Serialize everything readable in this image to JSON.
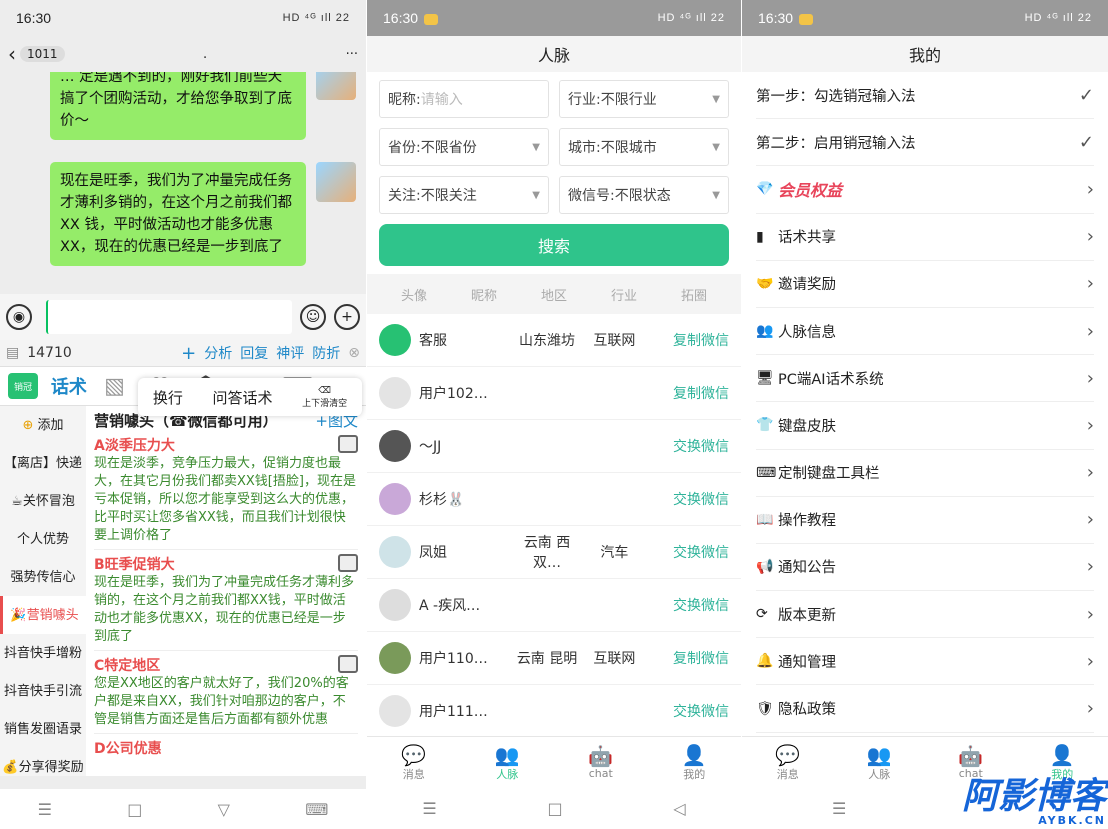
{
  "status": {
    "time": "16:30",
    "indicators": "HD ⁴ᴳ ıll 22"
  },
  "chat": {
    "back": "‹",
    "count": "1011",
    "title": ".",
    "more": "···",
    "msg1": "…  定是遇不到的，刚好我们前些天搞了个团购活动，才给您争取到了底价～",
    "msg2": "现在是旺季，我们为了冲量完成任务才薄利多销的，在这个月之前我们都 XX 钱，平时做活动也才能多优惠 XX，现在的优惠已经是一步到底了",
    "toolrow": {
      "num": "14710",
      "plus": "+",
      "items": [
        "分析",
        "回复",
        "神评",
        "防折"
      ],
      "close": "⊗"
    },
    "icons": {
      "logo": "销冠",
      "speech": "话术",
      "keyboard_ai": "AI"
    },
    "cats": [
      "添加",
      "【离店】快递",
      "☕关怀冒泡",
      "个人优势",
      "强势传信心",
      "🎉营销噱头",
      "抖音快手增粉",
      "抖音快手引流",
      "销售发圈语录",
      "💰分享得奖励"
    ],
    "active_cat": 5,
    "heading": "营销噱头（☎微信都可用）",
    "add": "+图文",
    "items": [
      {
        "t": "A淡季压力大",
        "b": "现在是淡季，竞争压力最大，促销力度也最大，在其它月份我们都卖XX钱[捂脸]，现在是亏本促销，所以您才能享受到这么大的优惠，比平时买让您多省XX钱，而且我们计划很快要上调价格了"
      },
      {
        "t": "B旺季促销大",
        "b": "现在是旺季，我们为了冲量完成任务才薄利多销的，在这个月之前我们都XX钱，平时做活动也才能多优惠XX，现在的优惠已经是一步到底了"
      },
      {
        "t": "C特定地区",
        "b": "您是XX地区的客户就太好了，我们20%的客户都是来自XX，我们针对咱那边的客户，不管是销售方面还是售后方面都有额外优惠"
      },
      {
        "t": "D公司优惠",
        "b": ""
      }
    ],
    "float": {
      "wrap": "换行",
      "qa": "问答话术",
      "del": "上下滑清空"
    }
  },
  "renmai": {
    "title": "人脉",
    "filters": [
      [
        "昵称:",
        "请输入"
      ],
      [
        "行业:不限行业"
      ],
      [
        "省份:不限省份"
      ],
      [
        "城市:不限城市"
      ],
      [
        "关注:不限关注"
      ],
      [
        "微信号:不限状态"
      ]
    ],
    "search": "搜索",
    "cols": [
      "头像",
      "昵称",
      "地区",
      "行业",
      "拓圈"
    ],
    "rows": [
      {
        "name": "客服",
        "region": "山东潍坊",
        "industry": "互联网",
        "act": "复制微信",
        "color": "#27c173"
      },
      {
        "name": "用户102…",
        "region": "",
        "industry": "",
        "act": "复制微信",
        "color": "#e4e4e4"
      },
      {
        "name": "～JJ",
        "region": "",
        "industry": "",
        "act": "交换微信",
        "color": "#555"
      },
      {
        "name": "杉杉🐰",
        "region": "",
        "industry": "",
        "act": "交换微信",
        "color": "#c9a8d8"
      },
      {
        "name": "凤姐",
        "region": "云南 西双…",
        "industry": "汽车",
        "act": "交换微信",
        "color": "#cfe3e8"
      },
      {
        "name": "A -疾风…",
        "region": "",
        "industry": "",
        "act": "交换微信",
        "color": "#ddd"
      },
      {
        "name": "用户110…",
        "region": "云南 昆明",
        "industry": "互联网",
        "act": "复制微信",
        "color": "#7a9a5a"
      },
      {
        "name": "用户111…",
        "region": "",
        "industry": "",
        "act": "交换微信",
        "color": "#e4e4e4"
      }
    ]
  },
  "mine": {
    "title": "我的",
    "items": [
      {
        "icon": "",
        "label": "第一步：勾选销冠输入法",
        "end": "✓"
      },
      {
        "icon": "",
        "label": "第二步：启用销冠输入法",
        "end": "✓"
      },
      {
        "icon": "💎",
        "label": "会员权益",
        "end": "›",
        "vip": true
      },
      {
        "icon": "▮",
        "label": "话术共享",
        "end": "›"
      },
      {
        "icon": "🤝",
        "label": "邀请奖励",
        "end": "›"
      },
      {
        "icon": "👥",
        "label": "人脉信息",
        "end": "›"
      },
      {
        "icon": "🖥",
        "label": "PC端AI话术系统",
        "end": "›"
      },
      {
        "icon": "👕",
        "label": "键盘皮肤",
        "end": "›"
      },
      {
        "icon": "⌨",
        "label": "定制键盘工具栏",
        "end": "›"
      },
      {
        "icon": "📖",
        "label": "操作教程",
        "end": "›"
      },
      {
        "icon": "📢",
        "label": "通知公告",
        "end": "›"
      },
      {
        "icon": "⟳",
        "label": "版本更新",
        "end": "›"
      },
      {
        "icon": "🔔",
        "label": "通知管理",
        "end": "›"
      },
      {
        "icon": "🛡",
        "label": "隐私政策",
        "end": "›"
      }
    ]
  },
  "tabs": [
    {
      "icon": "💬",
      "label": "消息"
    },
    {
      "icon": "👤",
      "label": "人脉"
    },
    {
      "icon": "🤖",
      "label": "chat"
    },
    {
      "icon": "👤",
      "label": "我的"
    }
  ],
  "sysnav": [
    "☰",
    "□",
    "◁"
  ],
  "watermark": {
    "cn": "阿影博客",
    "en": "AYBK.CN"
  }
}
